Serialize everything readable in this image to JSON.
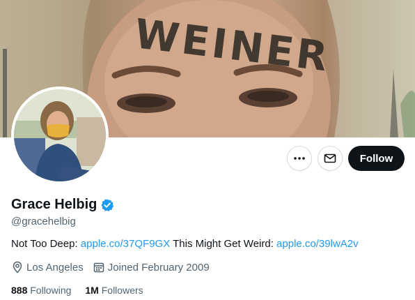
{
  "profile": {
    "name": "Grace Helbig",
    "handle": "@gracehelbig",
    "verified_color": "#1d9bf0",
    "bio": {
      "part1": "Not Too Deep: ",
      "link1": "apple.co/37QF9GX",
      "part2": " This Might Get Weird: ",
      "link2": "apple.co/39lwA2v"
    },
    "location": "Los Angeles",
    "joined": "Joined February 2009",
    "following_count": "888",
    "following_label": "Following",
    "followers_count": "1M",
    "followers_label": "Followers"
  },
  "banner": {
    "forehead_text": "WEINER"
  },
  "actions": {
    "more_icon": "ellipsis-icon",
    "message_icon": "envelope-icon",
    "follow_label": "Follow"
  },
  "colors": {
    "accent": "#1d9bf0",
    "follow_button": "#0f1419",
    "secondary_text": "#536471"
  }
}
